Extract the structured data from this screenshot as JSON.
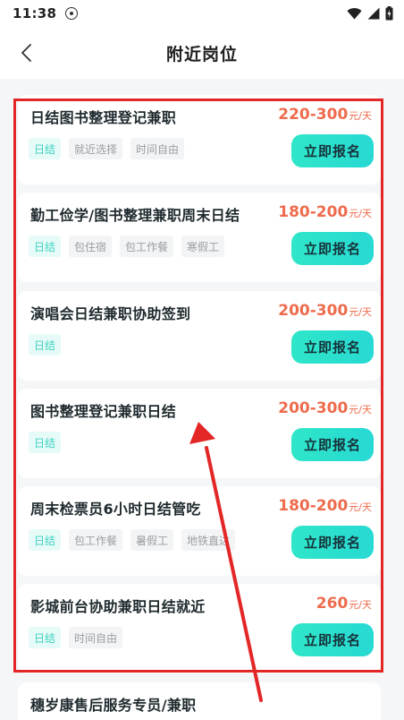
{
  "status_bar": {
    "time": "11:38"
  },
  "header": {
    "title": "附近岗位"
  },
  "jobs": [
    {
      "title": "日结图书整理登记兼职",
      "pay": "220-300",
      "unit": "元/天",
      "tags": [
        "日结",
        "就近选择",
        "时间自由"
      ],
      "button": "立即报名"
    },
    {
      "title": "勤工俭学/图书整理兼职周末日结",
      "pay": "180-200",
      "unit": "元/天",
      "tags": [
        "日结",
        "包住宿",
        "包工作餐",
        "寒假工"
      ],
      "button": "立即报名"
    },
    {
      "title": "演唱会日结兼职协助签到",
      "pay": "200-300",
      "unit": "元/天",
      "tags": [
        "日结"
      ],
      "button": "立即报名"
    },
    {
      "title": "图书整理登记兼职日结",
      "pay": "200-300",
      "unit": "元/天",
      "tags": [
        "日结"
      ],
      "button": "立即报名"
    },
    {
      "title": "周末检票员6小时日结管吃",
      "pay": "180-200",
      "unit": "元/天",
      "tags": [
        "日结",
        "包工作餐",
        "暑假工",
        "地铁直达"
      ],
      "button": "立即报名"
    },
    {
      "title": "影城前台协助兼职日结就近",
      "pay": "260",
      "unit": "元/天",
      "tags": [
        "日结",
        "时间自由"
      ],
      "button": "立即报名"
    },
    {
      "title": "穗岁康售后服务专员/兼职"
    }
  ],
  "colors": {
    "accent": "#2fe6c8",
    "pay": "#ee6b4d",
    "annotation": "#e32626"
  }
}
